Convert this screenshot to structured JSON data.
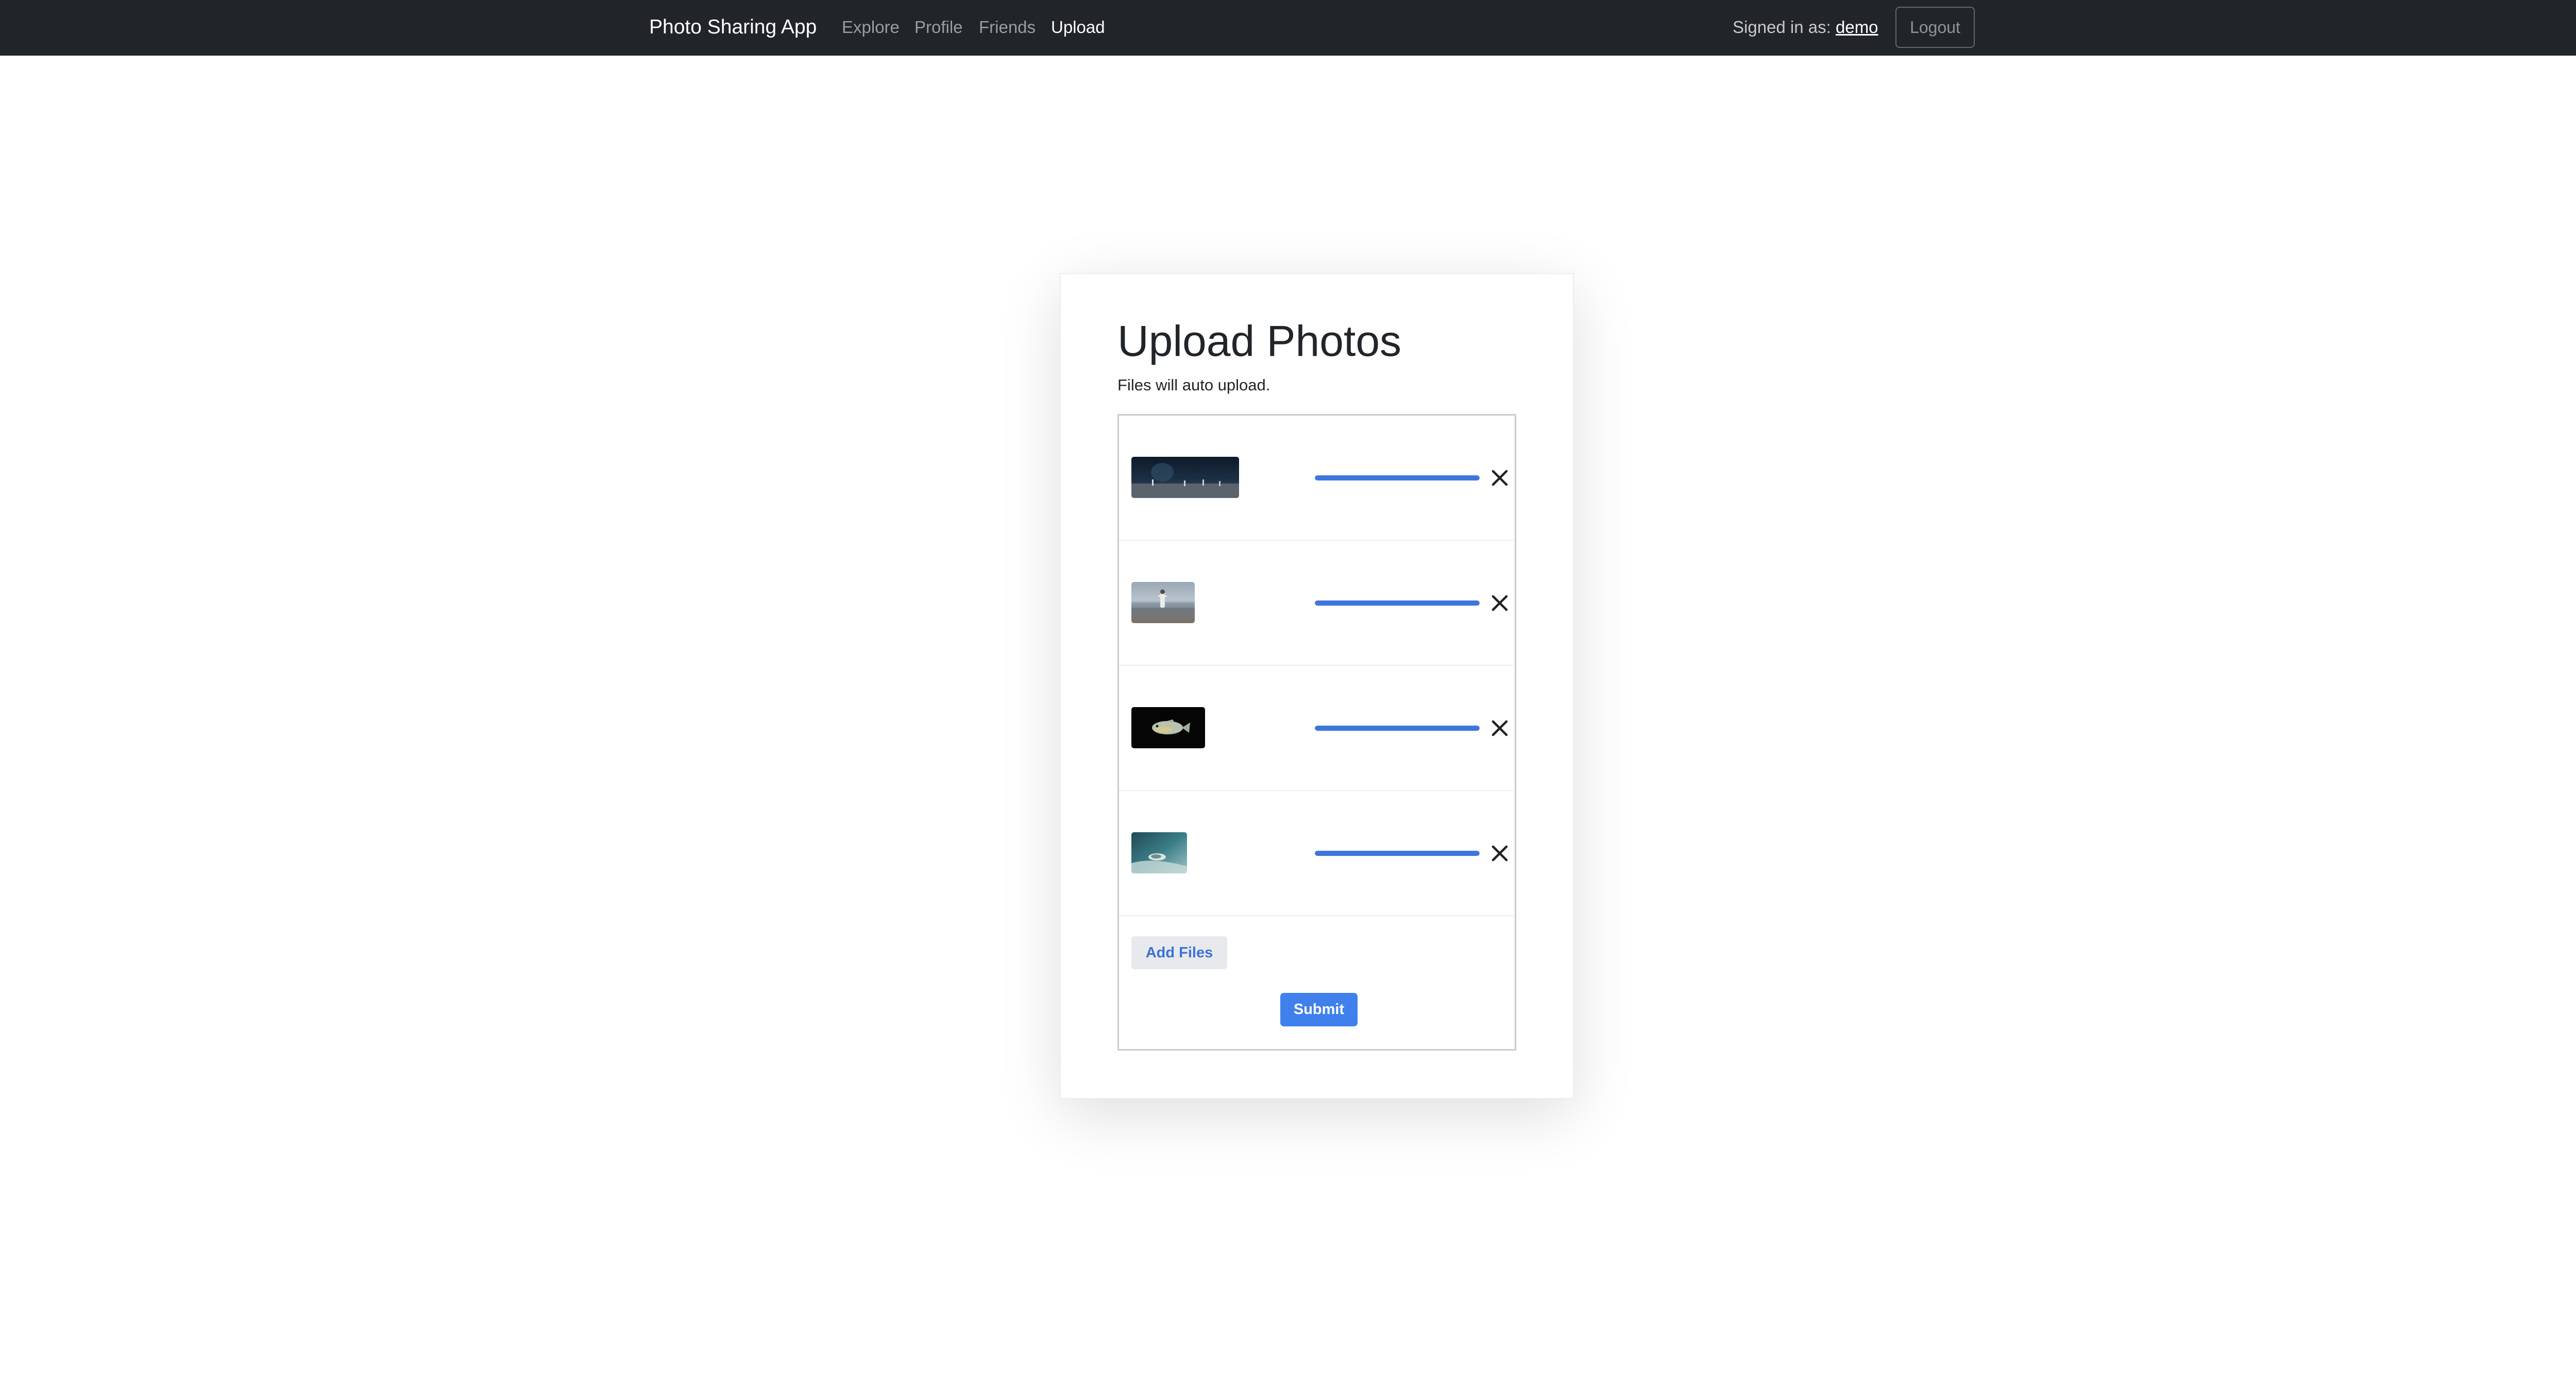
{
  "navbar": {
    "brand": "Photo Sharing App",
    "links": [
      {
        "label": "Explore",
        "active": false
      },
      {
        "label": "Profile",
        "active": false
      },
      {
        "label": "Friends",
        "active": false
      },
      {
        "label": "Upload",
        "active": true
      }
    ],
    "signed_in_label": "Signed in as:",
    "username": "demo",
    "logout_label": "Logout",
    "background": "#212529"
  },
  "upload": {
    "title": "Upload Photos",
    "subtitle": "Files will auto upload.",
    "files": [
      {
        "thumbnail": "night-beach-people",
        "progress": 1.0,
        "remove_icon": "close-icon"
      },
      {
        "thumbnail": "person-on-beach",
        "progress": 1.0,
        "remove_icon": "close-icon"
      },
      {
        "thumbnail": "fish-on-black",
        "progress": 1.0,
        "remove_icon": "close-icon"
      },
      {
        "thumbnail": "underwater-turtle",
        "progress": 1.0,
        "remove_icon": "close-icon"
      }
    ],
    "add_files_label": "Add Files",
    "submit_label": "Submit"
  },
  "colors": {
    "accent": "#3f80ec",
    "progress": "#3e76dc",
    "navbar": "#212529"
  }
}
